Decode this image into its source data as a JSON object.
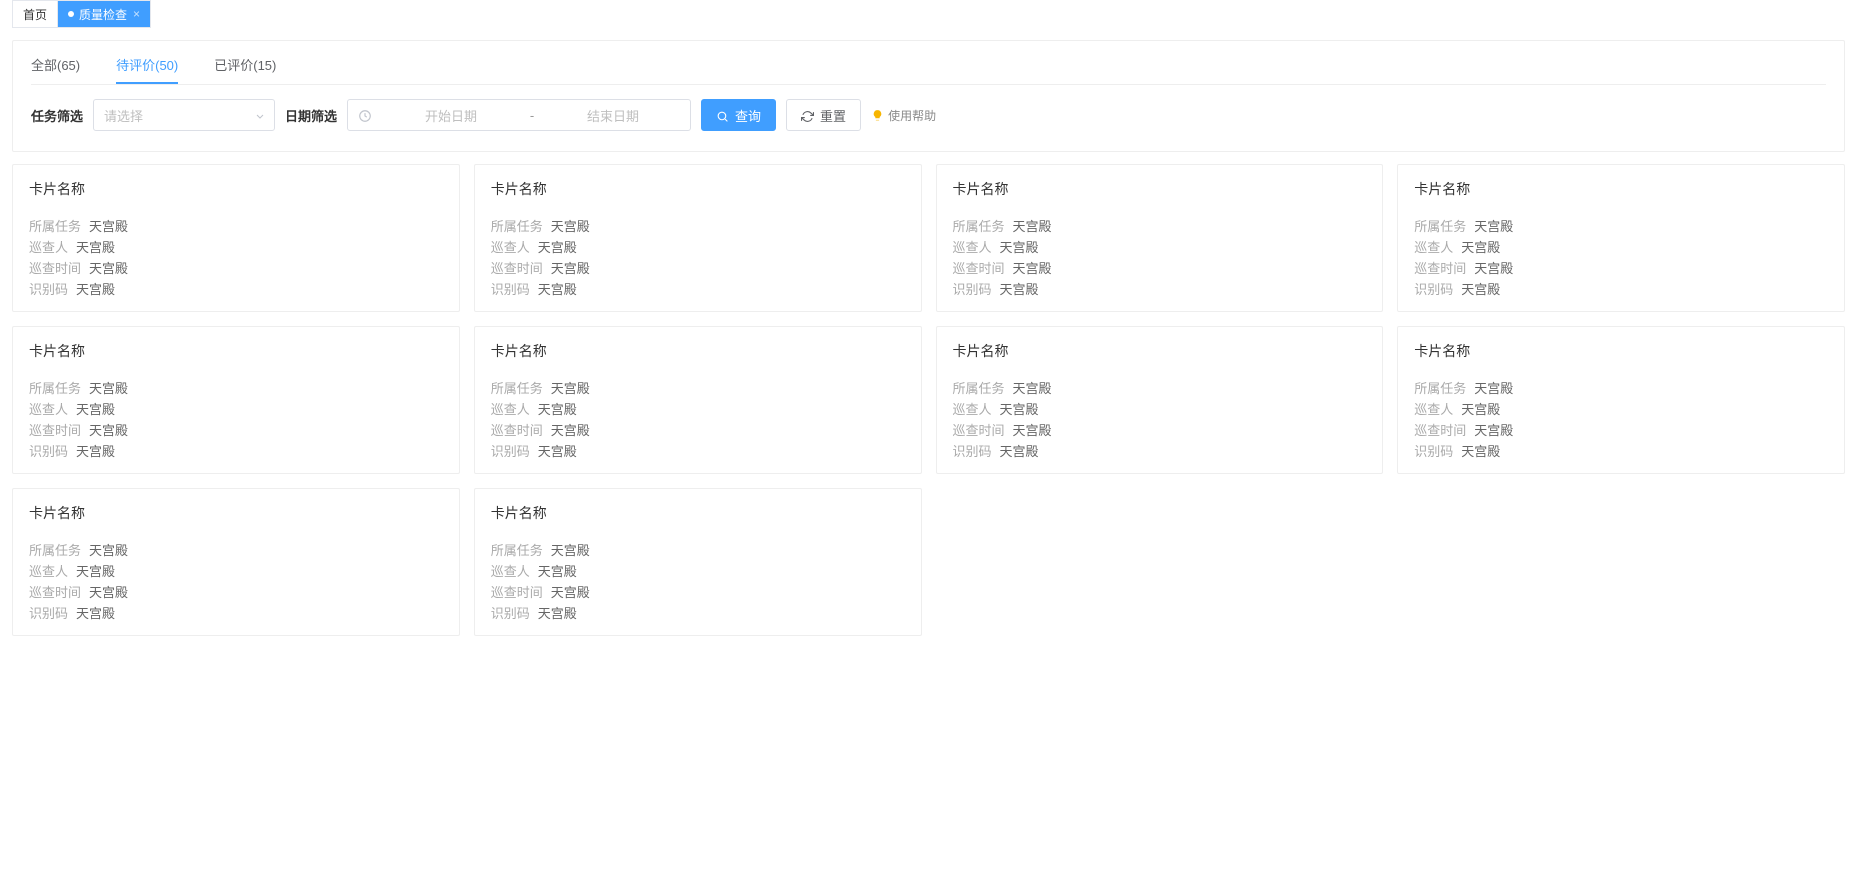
{
  "topTabs": [
    {
      "label": "首页",
      "active": false,
      "closable": false
    },
    {
      "label": "质量检查",
      "active": true,
      "closable": true
    }
  ],
  "filterTabs": [
    {
      "label": "全部(65)",
      "active": false
    },
    {
      "label": "待评价(50)",
      "active": true
    },
    {
      "label": "已评价(15)",
      "active": false
    }
  ],
  "filters": {
    "taskLabel": "任务筛选",
    "taskPlaceholder": "请选择",
    "dateLabel": "日期筛选",
    "startPlaceholder": "开始日期",
    "sep": "-",
    "endPlaceholder": "结束日期",
    "queryLabel": "查询",
    "resetLabel": "重置",
    "helpLabel": "使用帮助"
  },
  "cardFields": {
    "task": "所属任务",
    "inspector": "巡查人",
    "time": "巡查时间",
    "code": "识别码"
  },
  "cards": [
    {
      "title": "卡片名称",
      "task": "天宫殿",
      "inspector": "天宫殿",
      "time": "天宫殿",
      "code": "天宫殿"
    },
    {
      "title": "卡片名称",
      "task": "天宫殿",
      "inspector": "天宫殿",
      "time": "天宫殿",
      "code": "天宫殿"
    },
    {
      "title": "卡片名称",
      "task": "天宫殿",
      "inspector": "天宫殿",
      "time": "天宫殿",
      "code": "天宫殿"
    },
    {
      "title": "卡片名称",
      "task": "天宫殿",
      "inspector": "天宫殿",
      "time": "天宫殿",
      "code": "天宫殿"
    },
    {
      "title": "卡片名称",
      "task": "天宫殿",
      "inspector": "天宫殿",
      "time": "天宫殿",
      "code": "天宫殿"
    },
    {
      "title": "卡片名称",
      "task": "天宫殿",
      "inspector": "天宫殿",
      "time": "天宫殿",
      "code": "天宫殿"
    },
    {
      "title": "卡片名称",
      "task": "天宫殿",
      "inspector": "天宫殿",
      "time": "天宫殿",
      "code": "天宫殿"
    },
    {
      "title": "卡片名称",
      "task": "天宫殿",
      "inspector": "天宫殿",
      "time": "天宫殿",
      "code": "天宫殿"
    },
    {
      "title": "卡片名称",
      "task": "天宫殿",
      "inspector": "天宫殿",
      "time": "天宫殿",
      "code": "天宫殿"
    },
    {
      "title": "卡片名称",
      "task": "天宫殿",
      "inspector": "天宫殿",
      "time": "天宫殿",
      "code": "天宫殿"
    }
  ]
}
